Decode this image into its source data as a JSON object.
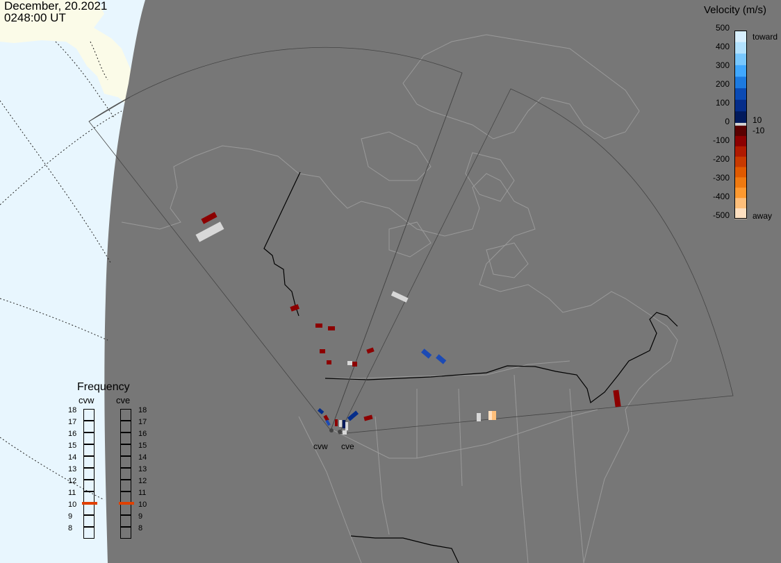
{
  "header": {
    "date": "December, 20.2021",
    "time": "0248:00 UT"
  },
  "velocity_scale": {
    "title": "Velocity (m/s)",
    "ticks": [
      "500",
      "400",
      "300",
      "200",
      "100",
      "0",
      "-100",
      "-200",
      "-300",
      "-400",
      "-500"
    ],
    "label_toward": "toward",
    "label_away": "away",
    "label_pos_threshold": "10",
    "label_neg_threshold": "-10",
    "colors_positive": [
      "#d8f0ff",
      "#b2e2ff",
      "#78c8ff",
      "#40a8ff",
      "#1c7ae0",
      "#0a4ab4",
      "#052d8a",
      "#021a5c"
    ],
    "colors_negative": [
      "#5a0000",
      "#8c0000",
      "#b01a00",
      "#c83a00",
      "#e05a00",
      "#f07a10",
      "#ff9a30",
      "#ffbf7a",
      "#ffe0c0"
    ]
  },
  "frequency_panel": {
    "title": "Frequency",
    "radars": [
      {
        "name": "cvw",
        "selected": 11
      },
      {
        "name": "cve",
        "selected": 11
      }
    ],
    "values": [
      "18",
      "17",
      "16",
      "15",
      "14",
      "13",
      "12",
      "11",
      "10",
      "9",
      "8"
    ],
    "marker_color": "#e04000"
  },
  "radars": [
    {
      "name": "cvw"
    },
    {
      "name": "cve"
    }
  ],
  "colors": {
    "land_and_fov_shade": "#777777",
    "ocean_daylight": "#e8f6fe",
    "land_daylight": "#fbfbe8",
    "borders": "#9a9a9a"
  }
}
